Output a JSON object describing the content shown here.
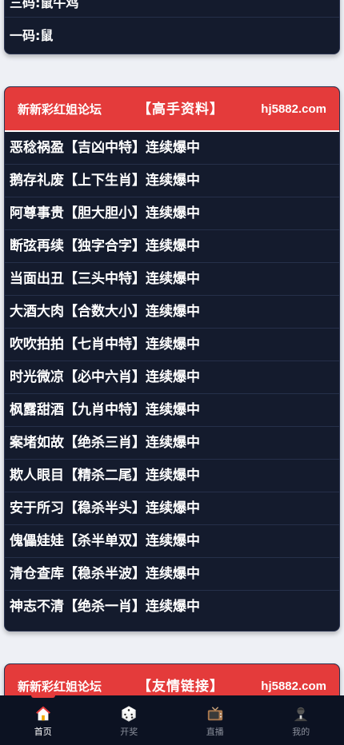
{
  "top_card": {
    "rows": [
      "三码:鼠牛鸡",
      "一码:鼠"
    ]
  },
  "card_master": {
    "forum": "新新彩红姐论坛",
    "section": "【高手资料】",
    "site": "hj5882.com",
    "items": [
      "恶稔祸盈【吉凶中特】连续爆中",
      "鹅存礼废【上下生肖】连续爆中",
      "阿尊事贵【胆大胆小】连续爆中",
      "断弦再续【独字合字】连续爆中",
      "当面出丑【三头中特】连续爆中",
      "大酒大肉【合数大小】连续爆中",
      "吹吹拍拍【七肖中特】连续爆中",
      "时光微凉【必中六肖】连续爆中",
      "枫露甜酒【九肖中特】连续爆中",
      "案堵如故【绝杀三肖】连续爆中",
      "欺人眼目【精杀二尾】连续爆中",
      "安于所习【稳杀半头】连续爆中",
      "傀儡娃娃【杀半单双】连续爆中",
      "清仓查库【稳杀半波】连续爆中",
      "神志不清【绝杀一肖】连续爆中"
    ]
  },
  "card_links": {
    "forum": "新新彩红姐论坛",
    "section": "【友情链接】",
    "site": "hj5882.com"
  },
  "bottom_nav": [
    {
      "label": "首页",
      "icon": "home-icon",
      "active": true
    },
    {
      "label": "开奖",
      "icon": "dice-icon",
      "active": false
    },
    {
      "label": "直播",
      "icon": "tv-icon",
      "active": false
    },
    {
      "label": "我的",
      "icon": "user-icon",
      "active": false
    }
  ],
  "colors": {
    "accent": "#e43b3b",
    "card_bg": "#141b2d",
    "page_bg": "#eef0f5",
    "nav_bg": "#0c1222"
  }
}
